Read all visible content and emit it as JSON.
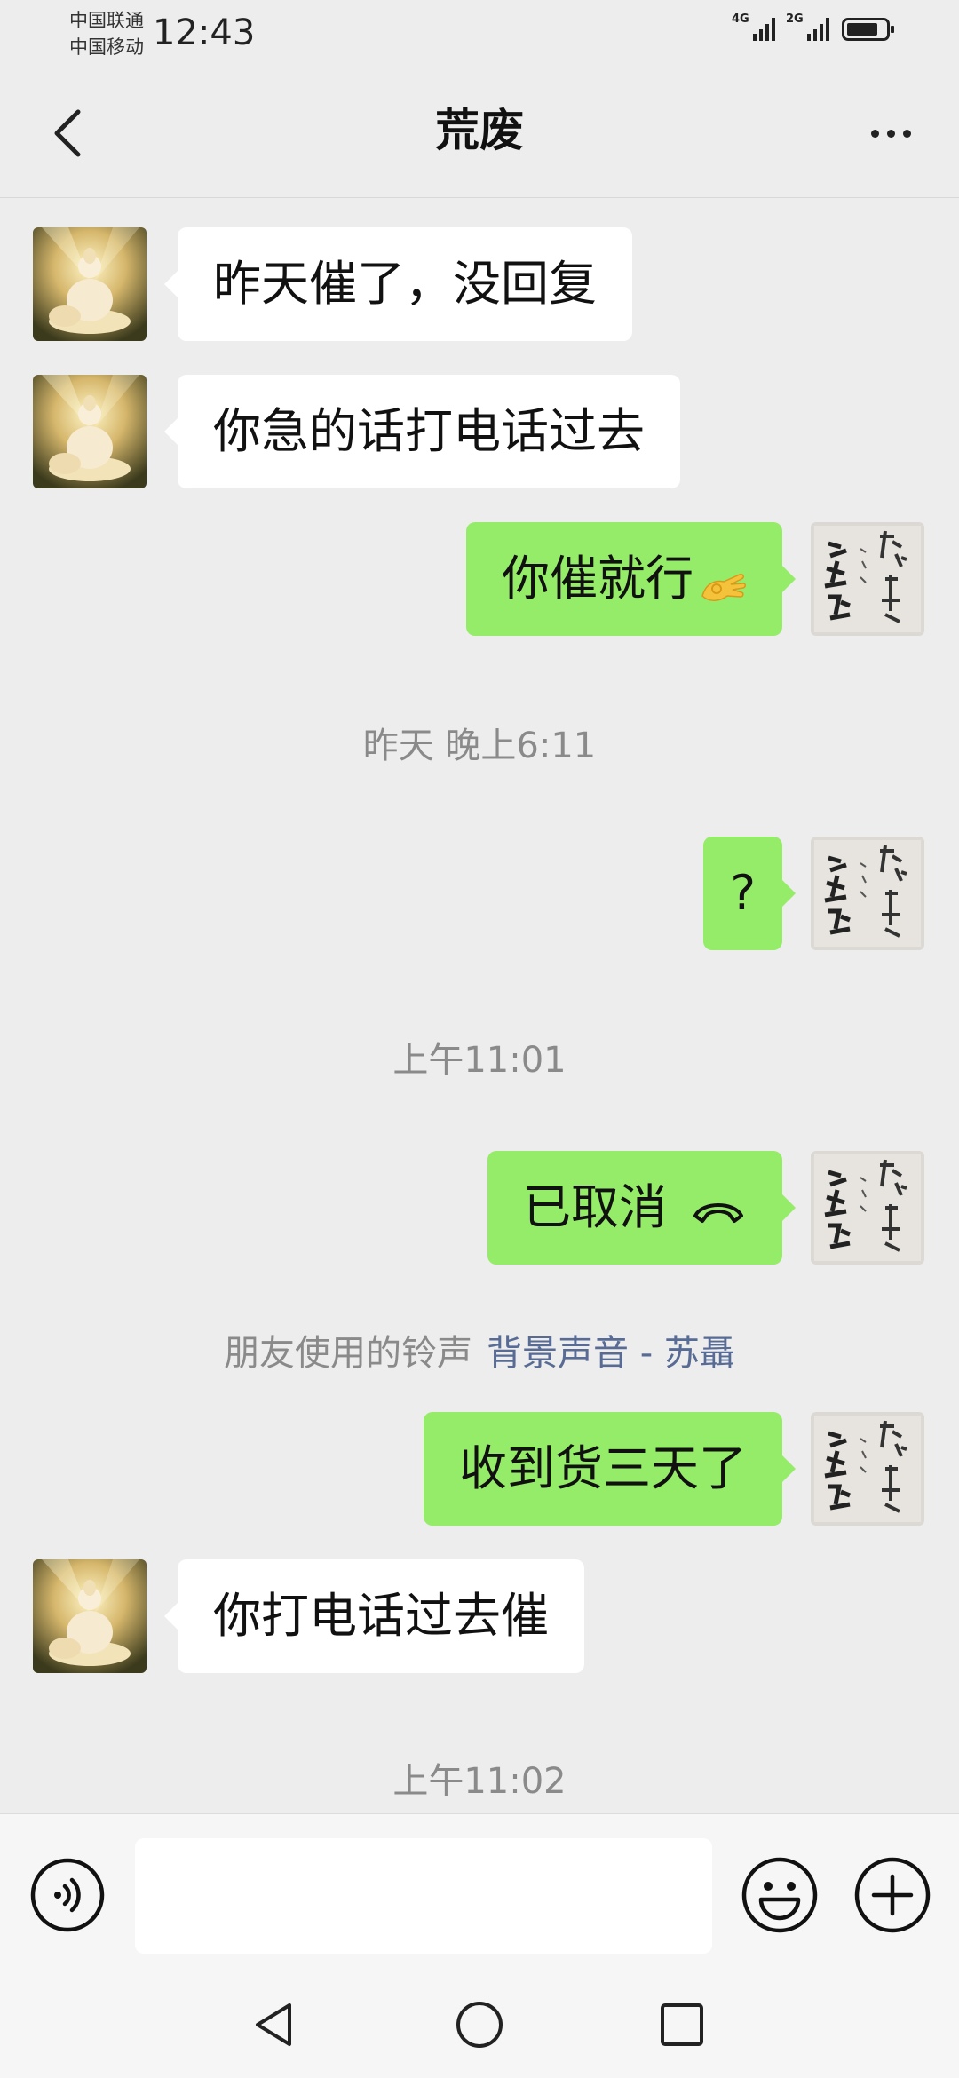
{
  "status_bar": {
    "carrier_1": "中国联通",
    "carrier_2": "中国移动",
    "time": "12:43",
    "network_1": "4G",
    "network_2": "2G"
  },
  "header": {
    "title": "荒废"
  },
  "messages": [
    {
      "side": "in",
      "text": "昨天催了，没回复"
    },
    {
      "side": "in",
      "text": "你急的话打电话过去"
    },
    {
      "side": "out",
      "text": "你催就行",
      "emoji": "ok-hand-emoji"
    },
    {
      "timestamp": "昨天 晚上6:11"
    },
    {
      "side": "out",
      "text": "?"
    },
    {
      "timestamp": "上午11:01"
    },
    {
      "side": "out",
      "text": "已取消",
      "icon": "call-cancelled-icon"
    },
    {
      "system_prefix": "朋友使用的铃声",
      "system_link": "背景声音 - 苏聶"
    },
    {
      "side": "out",
      "text": "收到货三天了"
    },
    {
      "side": "in",
      "text": "你打电话过去催"
    },
    {
      "timestamp": "上午11:02"
    }
  ],
  "colors": {
    "background": "#ededed",
    "outgoing_bubble": "#95ec69",
    "incoming_bubble": "#ffffff",
    "link": "#576b95"
  },
  "icons": {
    "voice": "voice-input-icon",
    "emoji": "emoji-icon",
    "plus": "plus-icon"
  }
}
